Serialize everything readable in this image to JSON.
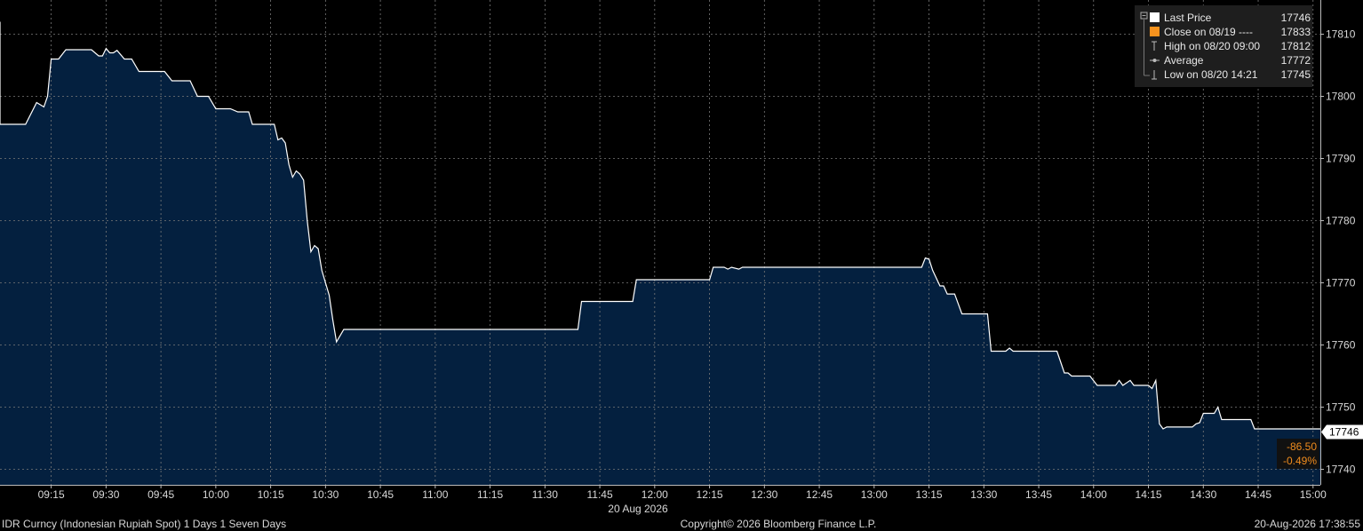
{
  "chart_data": {
    "type": "area",
    "date_label": "20 Aug 2026",
    "x_ticks": [
      "09:15",
      "09:30",
      "09:45",
      "10:00",
      "10:15",
      "10:30",
      "10:45",
      "11:00",
      "11:15",
      "11:30",
      "11:45",
      "12:00",
      "12:15",
      "12:30",
      "12:45",
      "13:00",
      "13:15",
      "13:30",
      "13:45",
      "14:00",
      "14:15",
      "14:30",
      "14:45",
      "15:00"
    ],
    "y_ticks": [
      17740,
      17750,
      17760,
      17770,
      17780,
      17790,
      17800,
      17810
    ],
    "ylim": [
      17737.5,
      17815.5
    ],
    "xlim": [
      "09:01",
      "15:02"
    ],
    "grid": true,
    "legend_position": "top-right",
    "series": [
      {
        "name": "Last Price",
        "color": "#ffffff",
        "fill": "#04203f",
        "points": [
          [
            "09:01",
            17812
          ],
          [
            "09:01",
            17795.5
          ],
          [
            "09:08",
            17795.5
          ],
          [
            "09:11",
            17799
          ],
          [
            "09:13",
            17798.3
          ],
          [
            "09:14",
            17800
          ],
          [
            "09:15",
            17806
          ],
          [
            "09:17",
            17806
          ],
          [
            "09:19",
            17807.5
          ],
          [
            "09:26",
            17807.5
          ],
          [
            "09:28",
            17806.5
          ],
          [
            "09:29",
            17806.5
          ],
          [
            "09:30",
            17807.7
          ],
          [
            "09:31",
            17807
          ],
          [
            "09:32",
            17807
          ],
          [
            "09:33",
            17807.4
          ],
          [
            "09:35",
            17806
          ],
          [
            "09:37",
            17806
          ],
          [
            "09:39",
            17804
          ],
          [
            "09:46",
            17804
          ],
          [
            "09:48",
            17802.5
          ],
          [
            "09:53",
            17802.5
          ],
          [
            "09:55",
            17800
          ],
          [
            "09:58",
            17800
          ],
          [
            "10:00",
            17798
          ],
          [
            "10:04",
            17798
          ],
          [
            "10:06",
            17797.5
          ],
          [
            "10:09",
            17797.5
          ],
          [
            "10:10",
            17795.5
          ],
          [
            "10:16",
            17795.5
          ],
          [
            "10:17",
            17793
          ],
          [
            "10:18",
            17793.3
          ],
          [
            "10:19",
            17792.5
          ],
          [
            "10:20",
            17789
          ],
          [
            "10:21",
            17787
          ],
          [
            "10:22",
            17788
          ],
          [
            "10:23",
            17787.5
          ],
          [
            "10:24",
            17786.5
          ],
          [
            "10:25",
            17780
          ],
          [
            "10:26",
            17775
          ],
          [
            "10:27",
            17776
          ],
          [
            "10:28",
            17775.5
          ],
          [
            "10:29",
            17772
          ],
          [
            "10:31",
            17768
          ],
          [
            "10:32",
            17764
          ],
          [
            "10:33",
            17760.5
          ],
          [
            "10:35",
            17762.5
          ],
          [
            "11:39",
            17762.5
          ],
          [
            "11:40",
            17767
          ],
          [
            "11:54",
            17767
          ],
          [
            "11:55",
            17770.5
          ],
          [
            "12:15",
            17770.5
          ],
          [
            "12:16",
            17772.5
          ],
          [
            "12:19",
            17772.5
          ],
          [
            "12:20",
            17772.2
          ],
          [
            "12:21",
            17772.5
          ],
          [
            "12:23",
            17772.2
          ],
          [
            "12:24",
            17772.5
          ],
          [
            "13:13",
            17772.5
          ],
          [
            "13:14",
            17774
          ],
          [
            "13:15",
            17773.8
          ],
          [
            "13:16",
            17772
          ],
          [
            "13:18",
            17769.5
          ],
          [
            "13:19",
            17769.5
          ],
          [
            "13:20",
            17768.2
          ],
          [
            "13:22",
            17768.2
          ],
          [
            "13:24",
            17765
          ],
          [
            "13:31",
            17765
          ],
          [
            "13:32",
            17759
          ],
          [
            "13:36",
            17759
          ],
          [
            "13:37",
            17759.5
          ],
          [
            "13:38",
            17759
          ],
          [
            "13:50",
            17759
          ],
          [
            "13:52",
            17755.5
          ],
          [
            "13:53",
            17755.5
          ],
          [
            "13:54",
            17755
          ],
          [
            "13:59",
            17755
          ],
          [
            "14:01",
            17753.5
          ],
          [
            "14:06",
            17753.5
          ],
          [
            "14:07",
            17754.3
          ],
          [
            "14:08",
            17753.5
          ],
          [
            "14:10",
            17754.3
          ],
          [
            "14:11",
            17753.5
          ],
          [
            "14:15",
            17753.5
          ],
          [
            "14:16",
            17753
          ],
          [
            "14:17",
            17754.3
          ],
          [
            "14:18",
            17747.3
          ],
          [
            "14:19",
            17746.5
          ],
          [
            "14:20",
            17746.8
          ],
          [
            "14:27",
            17746.8
          ],
          [
            "14:28",
            17747.3
          ],
          [
            "14:29",
            17747.5
          ],
          [
            "14:30",
            17749
          ],
          [
            "14:33",
            17749
          ],
          [
            "14:34",
            17750
          ],
          [
            "14:35",
            17748
          ],
          [
            "14:43",
            17748
          ],
          [
            "14:44",
            17746.5
          ],
          [
            "15:02",
            17746.5
          ]
        ]
      }
    ],
    "legend": [
      {
        "label": "Last Price",
        "value": "17746",
        "marker": "square",
        "color": "#ffffff"
      },
      {
        "label": "Close on 08/19 ----",
        "value": "17833",
        "marker": "square",
        "color": "#f7931e"
      },
      {
        "label": "High on 08/20 09:00",
        "value": "17812",
        "marker": "high",
        "color": "#bbbbbb"
      },
      {
        "label": "Average",
        "value": "17772",
        "marker": "avg",
        "color": "#bbbbbb"
      },
      {
        "label": "Low on 08/20 14:21",
        "value": "17745",
        "marker": "low",
        "color": "#bbbbbb"
      }
    ],
    "last_value_tag": "17746",
    "net_change": "-86.50",
    "pct_change": "-0.49%"
  },
  "footer": {
    "left": "IDR Curncy (Indonesian Rupiah Spot) 1 Days 1 Seven Days",
    "center": "Copyright© 2026 Bloomberg Finance L.P.",
    "right": "20-Aug-2026 17:38:55"
  },
  "colors": {
    "background": "#000000",
    "area_fill": "#04203f",
    "line": "#ffffff",
    "grid": "#7a7a7a",
    "change": "#f08c1e",
    "legend_bg": "#1e1e1e"
  }
}
